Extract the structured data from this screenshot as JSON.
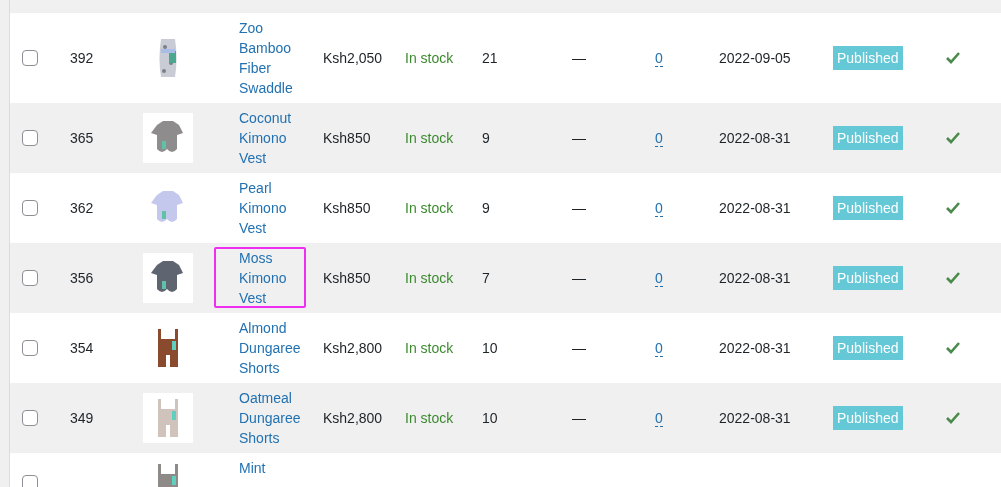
{
  "rows": [
    {
      "checked": false,
      "id": "392",
      "name": "Zoo Bamboo Fiber Swaddle",
      "price": "Ksh2,050",
      "stock": "In stock",
      "stock_count": "21",
      "column_7": "—",
      "reviews": "0",
      "date": "2022-09-05",
      "status": "Published",
      "featured": true,
      "highlighted": false
    },
    {
      "checked": false,
      "id": "365",
      "name": "Coconut Kimono Vest",
      "price": "Ksh850",
      "stock": "In stock",
      "stock_count": "9",
      "column_7": "—",
      "reviews": "0",
      "date": "2022-08-31",
      "status": "Published",
      "featured": true,
      "highlighted": false
    },
    {
      "checked": false,
      "id": "362",
      "name": "Pearl Kimono Vest",
      "price": "Ksh850",
      "stock": "In stock",
      "stock_count": "9",
      "column_7": "—",
      "reviews": "0",
      "date": "2022-08-31",
      "status": "Published",
      "featured": true,
      "highlighted": false
    },
    {
      "checked": false,
      "id": "356",
      "name": "Moss Kimono Vest",
      "price": "Ksh850",
      "stock": "In stock",
      "stock_count": "7",
      "column_7": "—",
      "reviews": "0",
      "date": "2022-08-31",
      "status": "Published",
      "featured": true,
      "highlighted": true
    },
    {
      "checked": false,
      "id": "354",
      "name": "Almond Dungaree Shorts",
      "price": "Ksh2,800",
      "stock": "In stock",
      "stock_count": "10",
      "column_7": "—",
      "reviews": "0",
      "date": "2022-08-31",
      "status": "Published",
      "featured": true,
      "highlighted": false
    },
    {
      "checked": false,
      "id": "349",
      "name": "Oatmeal Dungaree Shorts",
      "price": "Ksh2,800",
      "stock": "In stock",
      "stock_count": "10",
      "column_7": "—",
      "reviews": "0",
      "date": "2022-08-31",
      "status": "Published",
      "featured": true,
      "highlighted": false
    },
    {
      "checked": false,
      "name": "Mint",
      "highlighted": false
    }
  ]
}
